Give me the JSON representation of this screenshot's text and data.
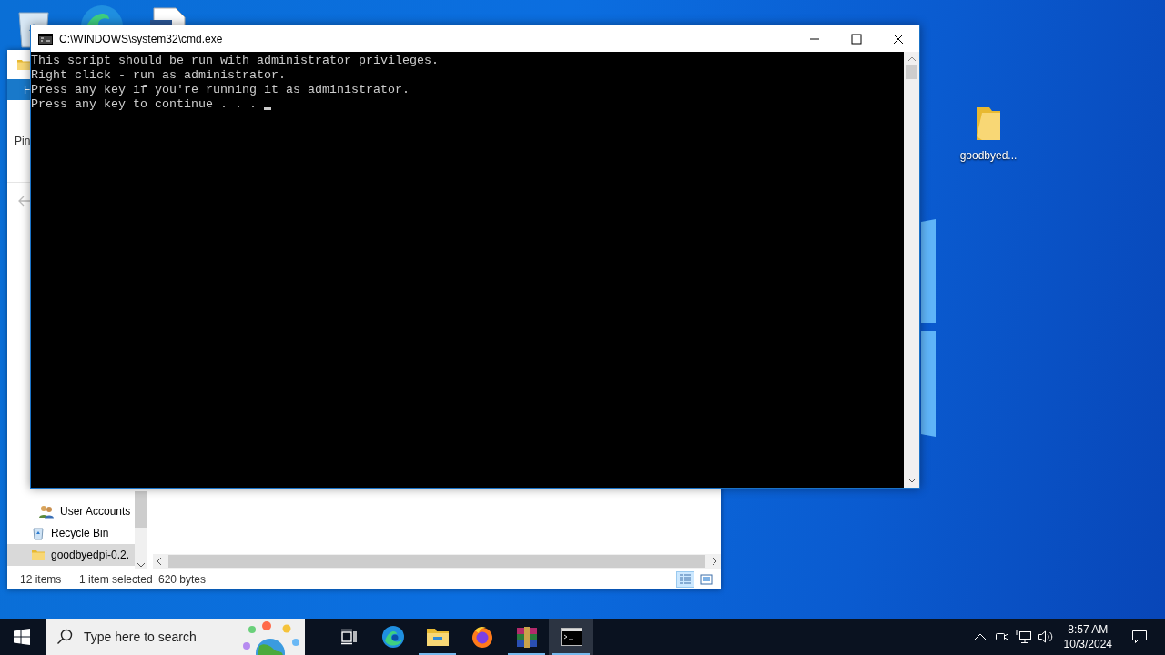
{
  "desktop": {
    "icons": [
      {
        "label": "goodbyed..."
      }
    ]
  },
  "explorer": {
    "ribbon_tab": "F",
    "ribbon_text": "Pin",
    "nav_tree": [
      {
        "children": [
          {
            "label": "User Accounts",
            "kind": "users",
            "selected": false
          }
        ]
      },
      {
        "label": "Recycle Bin",
        "kind": "recycle-bin",
        "selected": false
      },
      {
        "label": "goodbyedpi-0.2.",
        "kind": "folder",
        "selected": true
      }
    ],
    "status_bar": {
      "item_count": "12 items",
      "selection": "1 item selected",
      "size": "620 bytes"
    },
    "view_buttons": [
      {
        "kind": "details",
        "selected": true
      },
      {
        "kind": "thumbnails",
        "selected": false
      }
    ]
  },
  "console": {
    "title": "C:\\WINDOWS\\system32\\cmd.exe",
    "lines": [
      "This script should be run with administrator privileges.",
      "Right click - run as administrator.",
      "Press any key if you're running it as administrator.",
      "Press any key to continue . . . "
    ]
  },
  "taskbar": {
    "search_placeholder": "Type here to search",
    "apps": [
      {
        "kind": "task-view",
        "running": false,
        "selected": false
      },
      {
        "kind": "edge",
        "running": false,
        "selected": false
      },
      {
        "kind": "explorer",
        "running": true,
        "selected": false
      },
      {
        "kind": "firefox",
        "running": false,
        "selected": false
      },
      {
        "kind": "winrar",
        "running": true,
        "selected": false
      },
      {
        "kind": "cmd",
        "running": true,
        "selected": true
      }
    ],
    "clock": {
      "time": "8:57 AM",
      "date": "10/3/2024"
    }
  }
}
